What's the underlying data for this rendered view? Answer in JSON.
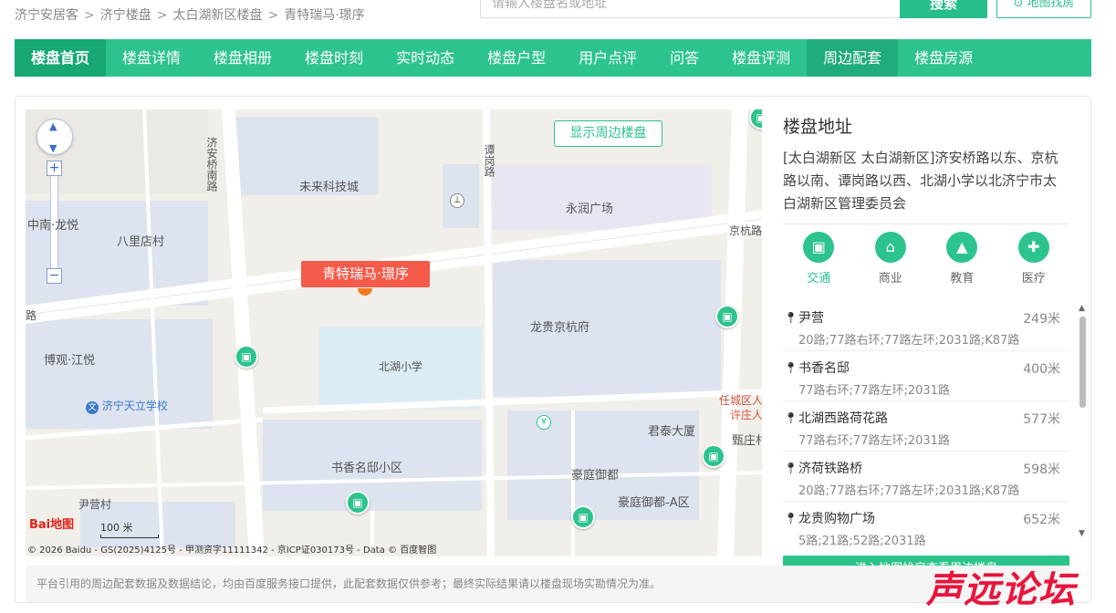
{
  "breadcrumb": [
    "济宁安居客",
    "济宁楼盘",
    "太白湖新区楼盘",
    "青特瑞马·璟序"
  ],
  "breadcrumb_sep": ">",
  "search": {
    "placeholder": "请输入楼盘名或地址",
    "button": "搜索",
    "map_find": "地图找房"
  },
  "nav_tabs": [
    "楼盘首页",
    "楼盘详情",
    "楼盘相册",
    "楼盘时刻",
    "实时动态",
    "楼盘户型",
    "用户点评",
    "问答",
    "楼盘评测",
    "周边配套",
    "楼盘房源"
  ],
  "nav_active": "周边配套",
  "map": {
    "show_nearby_button": "显示周边楼盘",
    "pin_label": "青特瑞马·璟序",
    "labels": {
      "weilai": "未来科技城",
      "yongrun": "永润广场",
      "zhongnan": "中南·龙悦",
      "balidian": "八里店村",
      "longgui": "龙贵京杭府",
      "boguan": "博观·江悦",
      "beihu": "北湖小学",
      "tianli": "济宁天立学校",
      "renchengqu": "任城区人",
      "xuzhuangcun": "许庄人",
      "juntai": "君泰大厦",
      "zhenzhuang": "甄庄村",
      "shuxiang": "书香名邸小区",
      "haoting": "豪庭御都",
      "haoting_a": "豪庭御都-A区",
      "yinying": "尹营村"
    },
    "roads": {
      "jianqiao": "济安桥南路",
      "tangang": "谭岗路",
      "jinghang": "京杭路",
      "lu": "路"
    },
    "scale": "100 米",
    "baidu_logo": "Bai地图",
    "copyright": "© 2026 Baidu - GS(2025)4125号 - 甲测资字11111342 - 京ICP证030173号 - Data © 百度智图"
  },
  "address": {
    "title": "楼盘地址",
    "text": "[太白湖新区 太白湖新区]济安桥路以东、京杭路以南、谭岗路以西、北湖小学以北济宁市太白湖新区管理委员会"
  },
  "categories": [
    {
      "label": "交通",
      "icon": "bus-icon"
    },
    {
      "label": "商业",
      "icon": "basket-icon"
    },
    {
      "label": "教育",
      "icon": "graduation-cap-icon"
    },
    {
      "label": "医疗",
      "icon": "medical-icon"
    }
  ],
  "category_active": "交通",
  "poi_list": [
    {
      "name": "尹营",
      "distance": "249米",
      "routes": "20路;77路右环;77路左环;2031路;K87路"
    },
    {
      "name": "书香名邸",
      "distance": "400米",
      "routes": "77路右环;77路左环;2031路"
    },
    {
      "name": "北湖西路荷花路",
      "distance": "577米",
      "routes": "77路右环;77路左环;2031路"
    },
    {
      "name": "济荷铁路桥",
      "distance": "598米",
      "routes": "20路;77路右环;77路左环;2031路;K87路"
    },
    {
      "name": "龙贵购物广场",
      "distance": "652米",
      "routes": "5路;21路;52路;2031路"
    }
  ],
  "enter_map_button": "进入地图找房查看周边楼盘",
  "notice": "平台引用的周边配套数据及数据结论，均由百度服务接口提供，此配套数据仅供参考；最终实际结果请以楼盘现场实勘情况为准。",
  "watermark": "声远论坛",
  "colors": {
    "accent": "#2dc38d",
    "pin": "#f45b4b",
    "watermark": "#e8153c"
  }
}
